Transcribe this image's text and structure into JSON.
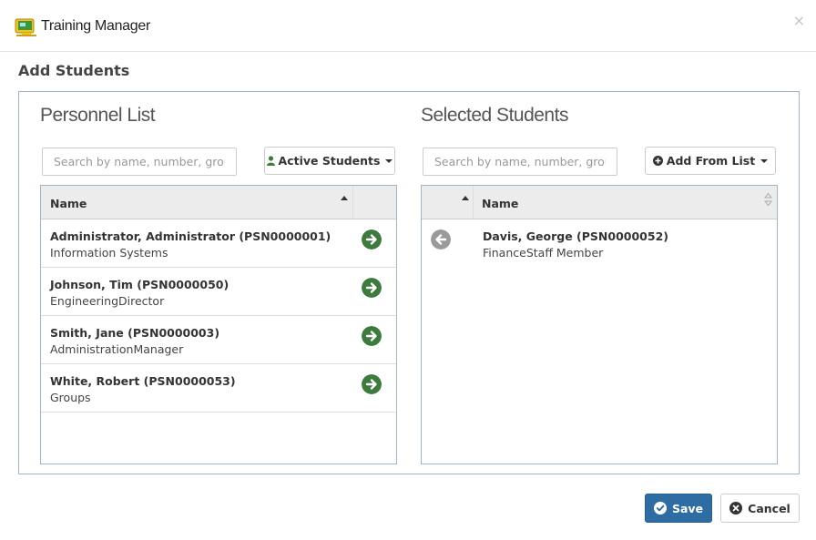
{
  "window": {
    "title": "Training Manager",
    "close_glyph": "×"
  },
  "section_title": "Add Students",
  "personnel": {
    "title": "Personnel List",
    "search_placeholder": "Search by name, number, group",
    "filter_label": "Active Students",
    "column_name": "Name",
    "rows": [
      {
        "name": "Administrator, Administrator (PSN0000001)",
        "detail": "Information Systems"
      },
      {
        "name": "Johnson, Tim (PSN0000050)",
        "detail": "EngineeringDirector"
      },
      {
        "name": "Smith, Jane (PSN0000003)",
        "detail": "AdministrationManager"
      },
      {
        "name": "White, Robert (PSN0000053)",
        "detail": "Groups"
      }
    ]
  },
  "selected": {
    "title": "Selected Students",
    "search_placeholder": "Search by name, number, group",
    "add_label": "Add From List",
    "column_name": "Name",
    "rows": [
      {
        "name": "Davis, George (PSN0000052)",
        "detail": "FinanceStaff Member"
      }
    ]
  },
  "footer": {
    "save_label": "Save",
    "cancel_label": "Cancel"
  },
  "icons": {
    "add_arrow": "arrow-circle-right-icon",
    "remove_arrow": "arrow-circle-left-icon",
    "user": "user-icon",
    "plus": "plus-circle-icon",
    "check": "check-circle-icon",
    "times": "times-circle-icon"
  },
  "colors": {
    "add_green": "#3d7a3d",
    "remove_gray": "#9a9a9a",
    "primary_blue": "#2e6da4"
  }
}
